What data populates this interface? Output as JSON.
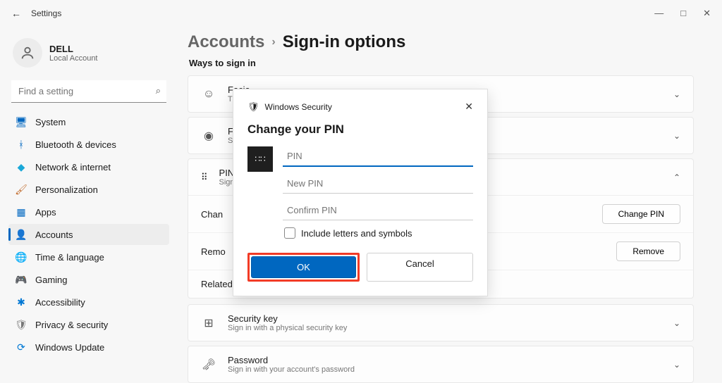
{
  "titlebar": {
    "title": "Settings"
  },
  "user": {
    "name": "DELL",
    "sub": "Local Account"
  },
  "search": {
    "placeholder": "Find a setting"
  },
  "nav": [
    {
      "label": "System",
      "icon": "🖥",
      "color": "#0067c0"
    },
    {
      "label": "Bluetooth & devices",
      "icon": "ᚼ",
      "color": "#0067c0"
    },
    {
      "label": "Network & internet",
      "icon": "◆",
      "color": "#1aa8d8"
    },
    {
      "label": "Personalization",
      "icon": "🖌",
      "color": "#c06a2a"
    },
    {
      "label": "Apps",
      "icon": "▦",
      "color": "#0067c0"
    },
    {
      "label": "Accounts",
      "icon": "👤",
      "color": "#5f7585",
      "active": true
    },
    {
      "label": "Time & language",
      "icon": "🌐",
      "color": "#3a6854"
    },
    {
      "label": "Gaming",
      "icon": "🎮",
      "color": "#6b7178"
    },
    {
      "label": "Accessibility",
      "icon": "✱",
      "color": "#0078d4"
    },
    {
      "label": "Privacy & security",
      "icon": "🛡",
      "color": "#777"
    },
    {
      "label": "Windows Update",
      "icon": "⟳",
      "color": "#0078d4"
    }
  ],
  "breadcrumb": {
    "parent": "Accounts",
    "current": "Sign-in options"
  },
  "section": "Ways to sign in",
  "options": {
    "facial": {
      "title": "Facia",
      "sub": "This o",
      "icon": "☺"
    },
    "finger": {
      "title": "Finge",
      "sub": "Sign i",
      "icon": "◉"
    },
    "pin": {
      "title": "PIN (",
      "sub": "Sign i",
      "icon": "⠿"
    },
    "security_key": {
      "title": "Security key",
      "sub": "Sign in with a physical security key",
      "icon": "⊞"
    },
    "password": {
      "title": "Password",
      "sub": "Sign in with your account's password",
      "icon": "🗝"
    }
  },
  "pin_rows": {
    "change_label_trunc": "Chan",
    "remove_label_trunc": "Remo",
    "related_label_trunc": "Related lin",
    "change_btn": "Change PIN",
    "remove_btn": "Remove"
  },
  "dialog": {
    "header": "Windows Security",
    "title": "Change your PIN",
    "pin_placeholder": "PIN",
    "newpin_placeholder": "New PIN",
    "confirm_placeholder": "Confirm PIN",
    "checkbox_label": "Include letters and symbols",
    "ok": "OK",
    "cancel": "Cancel"
  }
}
